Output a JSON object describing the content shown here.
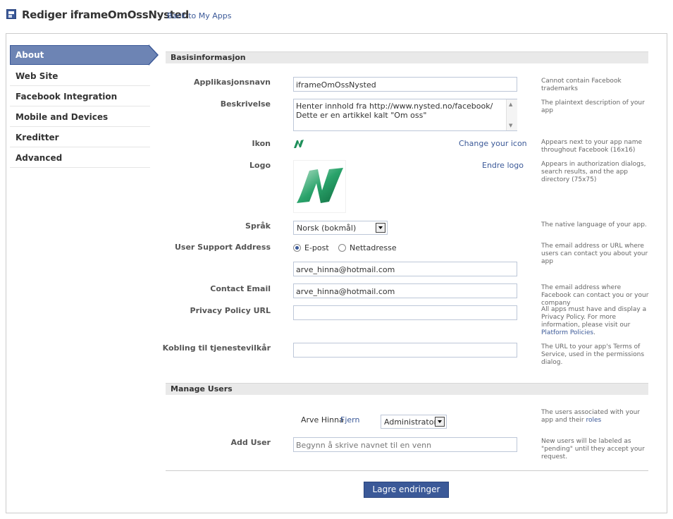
{
  "header": {
    "title": "Rediger iframeOmOssNysted",
    "back_link": "Back to My Apps"
  },
  "sidebar": {
    "items": [
      {
        "label": "About",
        "active": true
      },
      {
        "label": "Web Site"
      },
      {
        "label": "Facebook Integration"
      },
      {
        "label": "Mobile and Devices"
      },
      {
        "label": "Kreditter"
      },
      {
        "label": "Advanced"
      }
    ]
  },
  "basic": {
    "section_title": "Basisinformasjon",
    "app_name": {
      "label": "Applikasjonsnavn",
      "value": "iframeOmOssNysted",
      "help": "Cannot contain Facebook trademarks"
    },
    "description": {
      "label": "Beskrivelse",
      "line1": "Henter innhold fra http://www.nysted.no/facebook/",
      "line2": "Dette er en artikkel kalt \"Om oss\"",
      "help": "The plaintext description of your app"
    },
    "icon": {
      "label": "Ikon",
      "link": "Change your icon",
      "help": "Appears next to your app name throughout Facebook (16x16)"
    },
    "logo": {
      "label": "Logo",
      "link": "Endre logo",
      "help": "Appears in authorization dialogs, search results, and the app directory (75x75)"
    },
    "language": {
      "label": "Språk",
      "value": "Norsk (bokmål)",
      "help": "The native language of your app."
    },
    "support": {
      "label": "User Support Address",
      "option_email": "E-post",
      "option_url": "Nettadresse",
      "selected": "E-post",
      "value": "arve_hinna@hotmail.com",
      "help": "The email address or URL where users can contact you about your app"
    },
    "contact": {
      "label": "Contact Email",
      "value": "arve_hinna@hotmail.com",
      "help": "The email address where Facebook can contact you or your company"
    },
    "privacy": {
      "label": "Privacy Policy URL",
      "value": "",
      "help": "All apps must have and display a Privacy Policy. For more information, please visit our ",
      "help_link": "Platform Policies",
      "help_end": "."
    },
    "tos": {
      "label": "Kobling til tjenestevilkår",
      "value": "",
      "help": "The URL to your app's Terms of Service, used in the permissions dialog."
    }
  },
  "users": {
    "section_title": "Manage Users",
    "user_name": "Arve Hinna",
    "remove_link": "Fjern",
    "role": "Administrator",
    "help": "The users associated with your app and their ",
    "help_link": "roles",
    "add_label": "Add User",
    "add_placeholder": "Begynn å skrive navnet til en venn",
    "add_help": "New users will be labeled as \"pending\" until they accept your request."
  },
  "save_label": "Lagre endringer",
  "colors": {
    "brand": "#3b5998",
    "active_nav": "#6d84b4",
    "logo_green": "#1e8f5a"
  }
}
